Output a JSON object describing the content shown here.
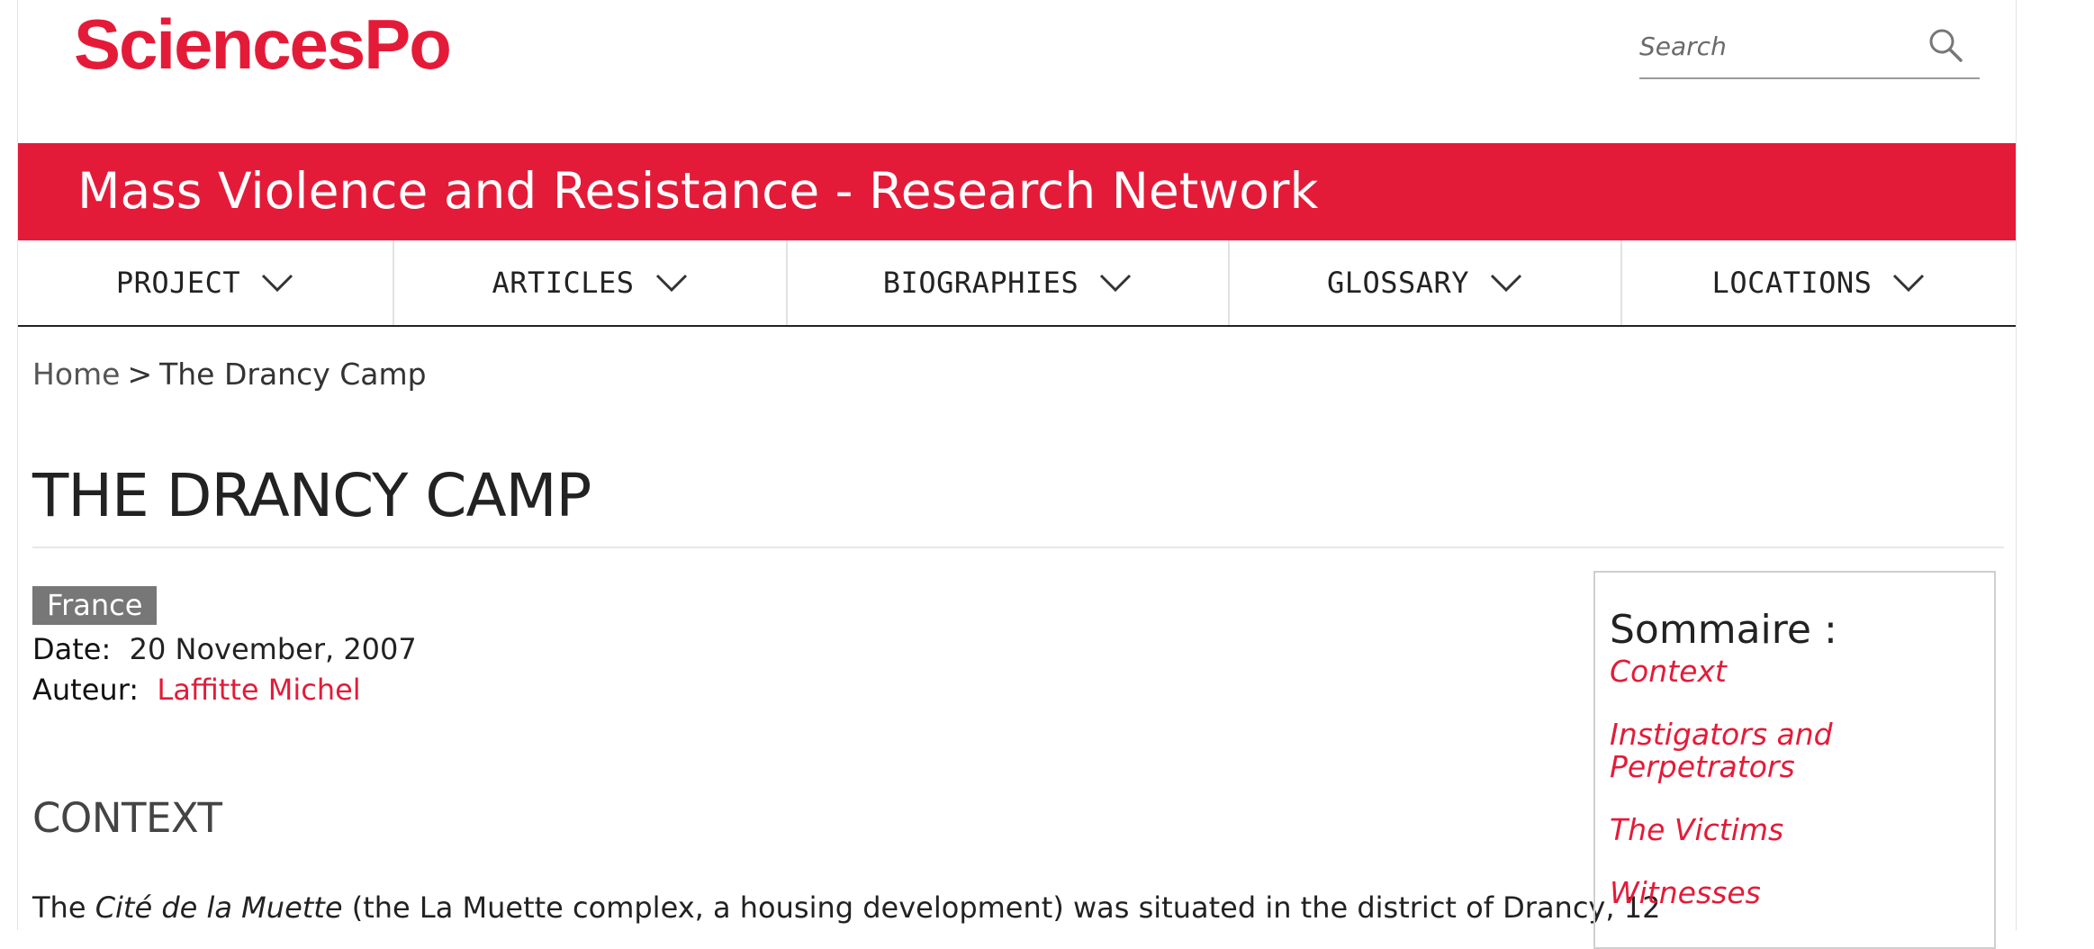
{
  "header": {
    "logo_text": "SciencesPo",
    "search_placeholder": "Search",
    "search_icon": "search-icon",
    "brand_color": "#e41b38"
  },
  "banner": {
    "title": "Mass Violence and Resistance - Research Network"
  },
  "nav": {
    "items": [
      {
        "label": "PROJECT"
      },
      {
        "label": "ARTICLES"
      },
      {
        "label": "BIOGRAPHIES"
      },
      {
        "label": "GLOSSARY"
      },
      {
        "label": "LOCATIONS"
      }
    ]
  },
  "breadcrumb": {
    "home": "Home",
    "separator": ">",
    "current": "The Drancy Camp"
  },
  "article": {
    "title": "THE DRANCY CAMP",
    "tag": "France",
    "date_label": "Date:",
    "date_value": "20 November, 2007",
    "author_label": "Auteur:",
    "author_value": "Laffitte Michel",
    "section_heading": "CONTEXT",
    "body_part1": "The ",
    "body_italic": "Cité de la Muette",
    "body_part2": " (the La Muette complex, a housing development) was situated in the district of Drancy, 12"
  },
  "sommaire": {
    "title": "Sommaire :",
    "links": [
      {
        "label": "Context"
      },
      {
        "label": "Instigators and Perpetrators"
      },
      {
        "label": "The Victims"
      },
      {
        "label": "Witnesses"
      }
    ]
  }
}
